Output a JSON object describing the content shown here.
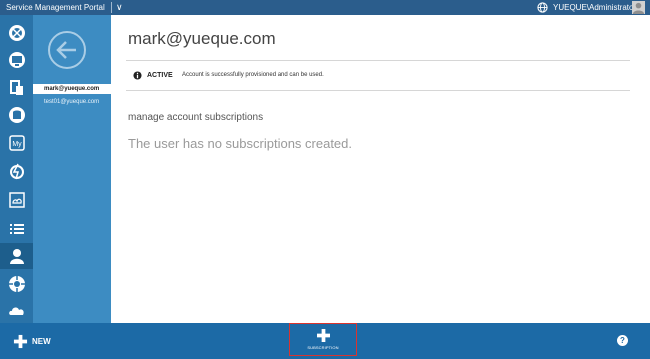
{
  "topbar": {
    "title": "Service Management Portal",
    "chevron": "∨",
    "user": "YUEQUE\\Administrator"
  },
  "nav": {
    "items": [
      {
        "icon": "websites-icon"
      },
      {
        "icon": "virtual-machines-icon"
      },
      {
        "icon": "service-bus-icon"
      },
      {
        "icon": "sql-server-icon"
      },
      {
        "icon": "mysql-icon"
      },
      {
        "icon": "automation-icon"
      },
      {
        "icon": "cloud-service-icon"
      },
      {
        "icon": "plans-icon"
      },
      {
        "icon": "user-accounts-icon",
        "active": true
      },
      {
        "icon": "ad-ons-icon"
      },
      {
        "icon": "cloud-icon"
      }
    ]
  },
  "list": {
    "items": [
      {
        "label": "mark@yueque.com",
        "selected": true
      },
      {
        "label": "test01@yueque.com",
        "selected": false
      }
    ]
  },
  "main": {
    "title": "mark@yueque.com",
    "status": {
      "label": "ACTIVE",
      "message": "Account is successfully provisioned and can be used."
    },
    "section_title": "manage account subscriptions",
    "empty_message": "The user has no subscriptions created."
  },
  "commandbar": {
    "new_label": "NEW",
    "subscription_label": "SUBSCRIPTION",
    "help_label": "?"
  },
  "colors": {
    "topbar": "#2b5d8c",
    "nav": "#2a73a8",
    "list_panel": "#3d8cc2",
    "commandbar": "#1c6aa6",
    "highlight_border": "#d9342f"
  }
}
